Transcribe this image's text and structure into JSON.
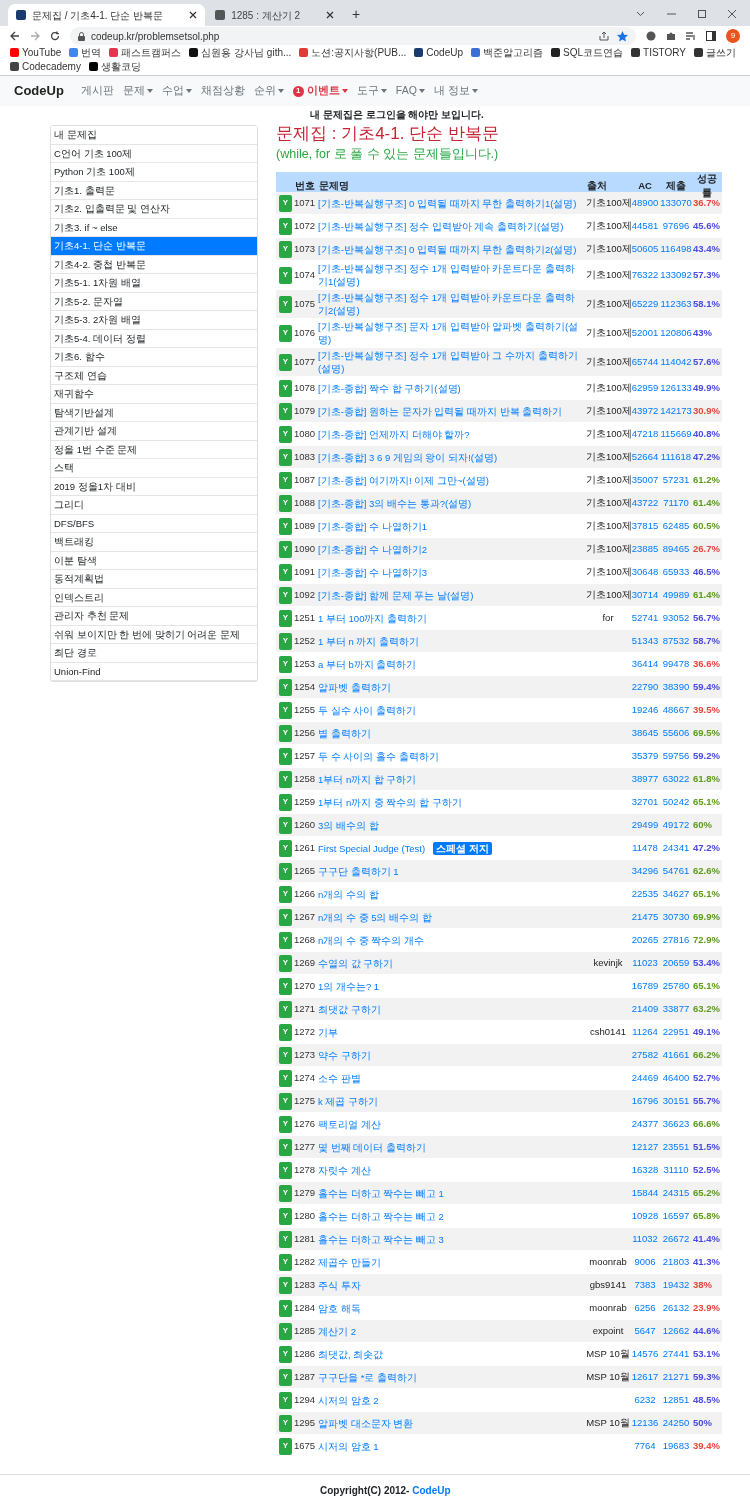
{
  "browser": {
    "tabs": [
      {
        "title": "문제집 / 기초4-1. 단순 반복문",
        "selected": true
      },
      {
        "title": "1285 : 계산기 2",
        "selected": false
      }
    ],
    "new_tab": "+",
    "url": "codeup.kr/problemsetsol.php",
    "profile": "9",
    "bookmarks": [
      {
        "label": "YouTube",
        "color": "#ff0000"
      },
      {
        "label": "번역",
        "color": "#4285f4"
      },
      {
        "label": "패스트캠퍼스",
        "color": "#e8344e"
      },
      {
        "label": "심원용 강사님 gith...",
        "color": "#111111"
      },
      {
        "label": "노션:공지사항(PUB...",
        "color": "#e53935"
      },
      {
        "label": "CodeUp",
        "color": "#1a3b6e"
      },
      {
        "label": "백준알고리즘",
        "color": "#3b6fd8"
      },
      {
        "label": "SQL코드연습",
        "color": "#222222"
      },
      {
        "label": "TISTORY",
        "color": "#333333"
      },
      {
        "label": "글쓰기",
        "color": "#333333"
      },
      {
        "label": "Codecademy",
        "color": "#444444"
      },
      {
        "label": "생활코딩",
        "color": "#000000"
      }
    ]
  },
  "navbar": {
    "brand": "CodeUp",
    "items": [
      {
        "label": "게시판",
        "dropdown": false
      },
      {
        "label": "문제",
        "dropdown": true
      },
      {
        "label": "수업",
        "dropdown": true
      },
      {
        "label": "채점상황",
        "dropdown": false
      },
      {
        "label": "순위",
        "dropdown": true
      },
      {
        "label": "이벤트",
        "dropdown": true,
        "count": "1"
      },
      {
        "label": "도구",
        "dropdown": true
      },
      {
        "label": "FAQ",
        "dropdown": true
      },
      {
        "label": "내 정보",
        "dropdown": true
      }
    ]
  },
  "notice": "내 문제집은 로그인을 해야만 보입니다.",
  "sidebar": {
    "items": [
      {
        "label": "내 문제집",
        "selected": false
      },
      {
        "label": "C언어 기초 100제",
        "selected": false
      },
      {
        "label": "Python 기초 100제",
        "selected": false
      },
      {
        "label": "기초1. 출력문",
        "selected": false
      },
      {
        "label": "기초2. 입출력문 및 연산자",
        "selected": false
      },
      {
        "label": "기초3. if ~ else",
        "selected": false
      },
      {
        "label": "기초4-1. 단순 반복문",
        "selected": true
      },
      {
        "label": "기초4-2. 중첩 반복문",
        "selected": false
      },
      {
        "label": "기초5-1. 1차원 배열",
        "selected": false
      },
      {
        "label": "기초5-2. 문자열",
        "selected": false
      },
      {
        "label": "기초5-3. 2차원 배열",
        "selected": false
      },
      {
        "label": "기초5-4. 데이터 정렬",
        "selected": false
      },
      {
        "label": "기초6. 함수",
        "selected": false
      },
      {
        "label": "구조체 연습",
        "selected": false
      },
      {
        "label": "재귀함수",
        "selected": false
      },
      {
        "label": "탐색기반설계",
        "selected": false
      },
      {
        "label": "관계기반 설계",
        "selected": false
      },
      {
        "label": "정올 1번 수준 문제",
        "selected": false
      },
      {
        "label": "스택",
        "selected": false
      },
      {
        "label": "2019 정올1차 대비",
        "selected": false
      },
      {
        "label": "그리디",
        "selected": false
      },
      {
        "label": "DFS/BFS",
        "selected": false
      },
      {
        "label": "백트래킹",
        "selected": false
      },
      {
        "label": "이분 탐색",
        "selected": false
      },
      {
        "label": "동적계획법",
        "selected": false
      },
      {
        "label": "인덱스트리",
        "selected": false
      },
      {
        "label": "관리자 추천 문제",
        "selected": false
      },
      {
        "label": "쉬워 보이지만 한 번에 맞히기 어려운 문제",
        "selected": false
      },
      {
        "label": "최단 경로",
        "selected": false
      },
      {
        "label": "Union-Find",
        "selected": false
      }
    ]
  },
  "title": "문제집 : 기초4-1. 단순 반복문",
  "subtitle": "(while, for 로 풀 수 있는 문제들입니다.)",
  "table": {
    "columns": [
      "번호",
      "문제명",
      "출처",
      "AC",
      "제출",
      "성공률"
    ],
    "rows": [
      {
        "mark": "Y",
        "id": "1071",
        "title": "[기초-반복실행구조] 0 입력될 때까지 무한 출력하기1(설명)",
        "source": "기초100제",
        "ac": "48900",
        "submitted": "133070",
        "rate": "36.7%",
        "color": "#e8453c"
      },
      {
        "mark": "Y",
        "id": "1072",
        "title": "[기초-반복실행구조] 정수 입력받아 계속 출력하기(설명)",
        "source": "기초100제",
        "ac": "44581",
        "submitted": "97696",
        "rate": "45.6%",
        "color": "#4a4ae0"
      },
      {
        "mark": "Y",
        "id": "1073",
        "title": "[기초-반복실행구조] 0 입력될 때까지 무한 출력하기2(설명)",
        "source": "기초100제",
        "ac": "50605",
        "submitted": "116498",
        "rate": "43.4%",
        "color": "#4a4ae0"
      },
      {
        "mark": "Y",
        "id": "1074",
        "title": "[기초-반복실행구조] 정수 1개 입력받아 카운트다운 출력하기1(설명)",
        "source": "기초100제",
        "ac": "76322",
        "submitted": "133092",
        "rate": "57.3%",
        "color": "#4a4ae0"
      },
      {
        "mark": "Y",
        "id": "1075",
        "title": "[기초-반복실행구조] 정수 1개 입력받아 카운트다운 출력하기2(설명)",
        "source": "기초100제",
        "ac": "65229",
        "submitted": "112363",
        "rate": "58.1%",
        "color": "#4a4ae0"
      },
      {
        "mark": "Y",
        "id": "1076",
        "title": "[기초-반복실행구조] 문자 1개 입력받아 알파벳 출력하기(설명)",
        "source": "기초100제",
        "ac": "52001",
        "submitted": "120806",
        "rate": "43%",
        "color": "#4a4ae0"
      },
      {
        "mark": "Y",
        "id": "1077",
        "title": "[기초-반복실행구조] 정수 1개 입력받아 그 수까지 출력하기(설명)",
        "source": "기초100제",
        "ac": "65744",
        "submitted": "114042",
        "rate": "57.6%",
        "color": "#4a4ae0"
      },
      {
        "mark": "Y",
        "id": "1078",
        "title": "[기초-종합] 짝수 합 구하기(설명)",
        "source": "기초100제",
        "ac": "62959",
        "submitted": "126133",
        "rate": "49.9%",
        "color": "#4a4ae0"
      },
      {
        "mark": "Y",
        "id": "1079",
        "title": "[기초-종합] 원하는 문자가 입력될 때까지 반복 출력하기",
        "source": "기초100제",
        "ac": "43972",
        "submitted": "142173",
        "rate": "30.9%",
        "color": "#e8453c"
      },
      {
        "mark": "Y",
        "id": "1080",
        "title": "[기초-종합] 언제까지 더해야 할까?",
        "source": "기초100제",
        "ac": "47218",
        "submitted": "115669",
        "rate": "40.8%",
        "color": "#4a4ae0"
      },
      {
        "mark": "Y",
        "id": "1083",
        "title": "[기초-종합] 3 6 9 게임의 왕이 되자!(설명)",
        "source": "기초100제",
        "ac": "52664",
        "submitted": "111618",
        "rate": "47.2%",
        "color": "#4a4ae0"
      },
      {
        "mark": "Y",
        "id": "1087",
        "title": "[기초-종합] 여기까지! 이제 그만~(설명)",
        "source": "기초100제",
        "ac": "35007",
        "submitted": "57231",
        "rate": "61.2%",
        "color": "#5c9a1b"
      },
      {
        "mark": "Y",
        "id": "1088",
        "title": "[기초-종합] 3의 배수는 통과?(설명)",
        "source": "기초100제",
        "ac": "43722",
        "submitted": "71170",
        "rate": "61.4%",
        "color": "#5c9a1b"
      },
      {
        "mark": "Y",
        "id": "1089",
        "title": "[기초-종합] 수 나열하기1",
        "source": "기초100제",
        "ac": "37815",
        "submitted": "62485",
        "rate": "60.5%",
        "color": "#5c9a1b"
      },
      {
        "mark": "Y",
        "id": "1090",
        "title": "[기초-종합] 수 나열하기2",
        "source": "기초100제",
        "ac": "23885",
        "submitted": "89465",
        "rate": "26.7%",
        "color": "#e8453c"
      },
      {
        "mark": "Y",
        "id": "1091",
        "title": "[기초-종합] 수 나열하기3",
        "source": "기초100제",
        "ac": "30648",
        "submitted": "65933",
        "rate": "46.5%",
        "color": "#4a4ae0"
      },
      {
        "mark": "Y",
        "id": "1092",
        "title": "[기초-종합] 함께 문제 푸는 날(설명)",
        "source": "기초100제",
        "ac": "30714",
        "submitted": "49989",
        "rate": "61.4%",
        "color": "#5c9a1b"
      },
      {
        "mark": "Y",
        "id": "1251",
        "title": "1 부터 100까지 출력하기",
        "source": "for",
        "ac": "52741",
        "submitted": "93052",
        "rate": "56.7%",
        "color": "#4a4ae0"
      },
      {
        "mark": "Y",
        "id": "1252",
        "title": "1 부터 n 까지 출력하기",
        "ac": "51343",
        "submitted": "87532",
        "rate": "58.7%",
        "color": "#4a4ae0"
      },
      {
        "mark": "Y",
        "id": "1253",
        "title": "a 부터 b까지 출력하기",
        "ac": "36414",
        "submitted": "99478",
        "rate": "36.6%",
        "color": "#e8453c"
      },
      {
        "mark": "Y",
        "id": "1254",
        "title": "알파벳 출력하기",
        "ac": "22790",
        "submitted": "38390",
        "rate": "59.4%",
        "color": "#4a4ae0"
      },
      {
        "mark": "Y",
        "id": "1255",
        "title": "두 실수 사이 출력하기",
        "ac": "19246",
        "submitted": "48667",
        "rate": "39.5%",
        "color": "#e8453c"
      },
      {
        "mark": "Y",
        "id": "1256",
        "title": "별 출력하기",
        "ac": "38645",
        "submitted": "55606",
        "rate": "69.5%",
        "color": "#5c9a1b"
      },
      {
        "mark": "Y",
        "id": "1257",
        "title": "두 수 사이의 홀수 출력하기",
        "ac": "35379",
        "submitted": "59756",
        "rate": "59.2%",
        "color": "#4a4ae0"
      },
      {
        "mark": "Y",
        "id": "1258",
        "title": "1부터 n까지 합 구하기",
        "ac": "38977",
        "submitted": "63022",
        "rate": "61.8%",
        "color": "#5c9a1b"
      },
      {
        "mark": "Y",
        "id": "1259",
        "title": "1부터 n까지 중 짝수의 합 구하기",
        "ac": "32701",
        "submitted": "50242",
        "rate": "65.1%",
        "color": "#5c9a1b"
      },
      {
        "mark": "Y",
        "id": "1260",
        "title": "3의 배수의 합",
        "ac": "29499",
        "submitted": "49172",
        "rate": "60%",
        "color": "#5c9a1b"
      },
      {
        "mark": "Y",
        "id": "1261",
        "title": "First Special Judge (Test)",
        "tag": "스페셜 저지",
        "ac": "11478",
        "submitted": "24341",
        "rate": "47.2%",
        "color": "#4a4ae0"
      },
      {
        "mark": "Y",
        "id": "1265",
        "title": "구구단 출력하기 1",
        "ac": "34296",
        "submitted": "54761",
        "rate": "62.6%",
        "color": "#5c9a1b"
      },
      {
        "mark": "Y",
        "id": "1266",
        "title": "n개의 수의 합",
        "ac": "22535",
        "submitted": "34627",
        "rate": "65.1%",
        "color": "#5c9a1b"
      },
      {
        "mark": "Y",
        "id": "1267",
        "title": "n개의 수 중 5의 배수의 합",
        "ac": "21475",
        "submitted": "30730",
        "rate": "69.9%",
        "color": "#5c9a1b"
      },
      {
        "mark": "Y",
        "id": "1268",
        "title": "n개의 수 중 짝수의 개수",
        "ac": "20265",
        "submitted": "27816",
        "rate": "72.9%",
        "color": "#5c9a1b"
      },
      {
        "mark": "Y",
        "id": "1269",
        "title": "수열의 값 구하기",
        "source": "kevinjk",
        "ac": "11023",
        "submitted": "20659",
        "rate": "53.4%",
        "color": "#4a4ae0"
      },
      {
        "mark": "Y",
        "id": "1270",
        "title": "1의 개수는? 1",
        "ac": "16789",
        "submitted": "25780",
        "rate": "65.1%",
        "color": "#5c9a1b"
      },
      {
        "mark": "Y",
        "id": "1271",
        "title": "최댓값 구하기",
        "ac": "21409",
        "submitted": "33877",
        "rate": "63.2%",
        "color": "#5c9a1b"
      },
      {
        "mark": "Y",
        "id": "1272",
        "title": "기부",
        "source": "csh0141",
        "ac": "11264",
        "submitted": "22951",
        "rate": "49.1%",
        "color": "#4a4ae0"
      },
      {
        "mark": "Y",
        "id": "1273",
        "title": "약수 구하기",
        "ac": "27582",
        "submitted": "41661",
        "rate": "66.2%",
        "color": "#5c9a1b"
      },
      {
        "mark": "Y",
        "id": "1274",
        "title": "소수 판별",
        "ac": "24469",
        "submitted": "46400",
        "rate": "52.7%",
        "color": "#4a4ae0"
      },
      {
        "mark": "Y",
        "id": "1275",
        "title": "k 제곱 구하기",
        "ac": "16796",
        "submitted": "30151",
        "rate": "55.7%",
        "color": "#4a4ae0"
      },
      {
        "mark": "Y",
        "id": "1276",
        "title": "팩토리얼 계산",
        "ac": "24377",
        "submitted": "36623",
        "rate": "66.6%",
        "color": "#5c9a1b"
      },
      {
        "mark": "Y",
        "id": "1277",
        "title": "몇 번째 데이터 출력하기",
        "ac": "12127",
        "submitted": "23551",
        "rate": "51.5%",
        "color": "#4a4ae0"
      },
      {
        "mark": "Y",
        "id": "1278",
        "title": "자릿수 계산",
        "ac": "16328",
        "submitted": "31110",
        "rate": "52.5%",
        "color": "#4a4ae0"
      },
      {
        "mark": "Y",
        "id": "1279",
        "title": "홀수는 더하고 짝수는 빼고 1",
        "ac": "15844",
        "submitted": "24315",
        "rate": "65.2%",
        "color": "#5c9a1b"
      },
      {
        "mark": "Y",
        "id": "1280",
        "title": "홀수는 더하고 짝수는 빼고 2",
        "ac": "10928",
        "submitted": "16597",
        "rate": "65.8%",
        "color": "#5c9a1b"
      },
      {
        "mark": "Y",
        "id": "1281",
        "title": "홀수는 더하고 짝수는 빼고 3",
        "ac": "11032",
        "submitted": "26672",
        "rate": "41.4%",
        "color": "#4a4ae0"
      },
      {
        "mark": "Y",
        "id": "1282",
        "title": "제곱수 만들기",
        "source": "moonrab",
        "ac": "9006",
        "submitted": "21803",
        "rate": "41.3%",
        "color": "#4a4ae0"
      },
      {
        "mark": "Y",
        "id": "1283",
        "title": "주식 투자",
        "source": "gbs9141",
        "ac": "7383",
        "submitted": "19432",
        "rate": "38%",
        "color": "#e8453c"
      },
      {
        "mark": "Y",
        "id": "1284",
        "title": "암호 해독",
        "source": "moonrab",
        "ac": "6256",
        "submitted": "26132",
        "rate": "23.9%",
        "color": "#e8453c"
      },
      {
        "mark": "Y",
        "id": "1285",
        "title": "계산기 2",
        "source": "expoint",
        "ac": "5647",
        "submitted": "12662",
        "rate": "44.6%",
        "color": "#4a4ae0"
      },
      {
        "mark": "Y",
        "id": "1286",
        "title": "최댓값, 최솟값",
        "source": "MSP 10월",
        "ac": "14576",
        "submitted": "27441",
        "rate": "53.1%",
        "color": "#4a4ae0"
      },
      {
        "mark": "Y",
        "id": "1287",
        "title": "구구단을 *로 출력하기",
        "source": "MSP 10월",
        "ac": "12617",
        "submitted": "21271",
        "rate": "59.3%",
        "color": "#4a4ae0"
      },
      {
        "mark": "Y",
        "id": "1294",
        "title": "시저의 암호 2",
        "ac": "6232",
        "submitted": "12851",
        "rate": "48.5%",
        "color": "#4a4ae0"
      },
      {
        "mark": "Y",
        "id": "1295",
        "title": "알파벳 대소문자 변환",
        "source": "MSP 10월",
        "ac": "12136",
        "submitted": "24250",
        "rate": "50%",
        "color": "#4a4ae0"
      },
      {
        "mark": "Y",
        "id": "1675",
        "title": "시저의 암호 1",
        "ac": "7764",
        "submitted": "19683",
        "rate": "39.4%",
        "color": "#e8453c"
      }
    ]
  },
  "footer": {
    "copyright": "Copyright(C) 2012- ",
    "link": "CodeUp"
  }
}
